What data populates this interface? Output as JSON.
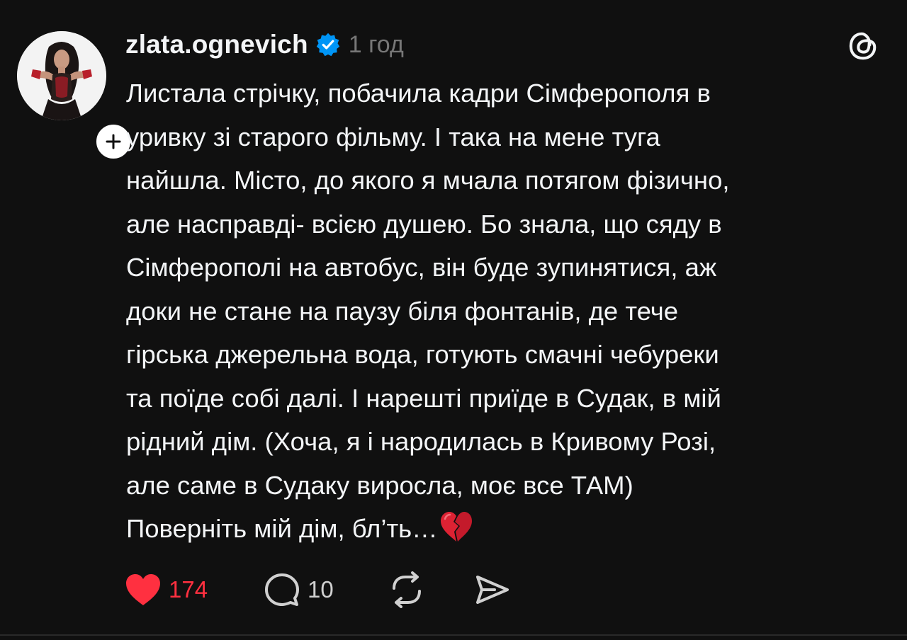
{
  "post": {
    "username": "zlata.ognevich",
    "verified": true,
    "timestamp": "1 год",
    "text_lines": [
      "Листала стрічку, побачила кадри Сімферополя в",
      "уривку зі старого фільму. І така на мене туга",
      "найшла. Місто, до якого я мчала потягом фізично,",
      "але насправді- всією душею. Бо знала, що сяду в",
      "Сімферополі на автобус, він буде зупинятися, аж",
      "доки не стане на паузу біля фонтанів, де тече",
      "гірська джерельна вода, готують смачні чебуреки",
      "та поїде собі далі. І нарешті приїде в Судак, в мій",
      "рідний дім. (Хоча, я і народилась в Кривому Розі,",
      "але саме в Судаку виросла, моє все ТАМ)",
      "Поверніть мій дім, бл’ть…"
    ],
    "emoji": "broken-heart-emoji"
  },
  "actions": {
    "likes": "174",
    "replies": "10",
    "liked": true
  },
  "colors": {
    "background": "#101010",
    "text": "#f3f5f7",
    "muted": "#777777",
    "like": "#ff3040",
    "verified": "#0095f6"
  },
  "icons": {
    "follow": "plus-icon",
    "verified": "verified-badge-icon",
    "logo": "threads-logo-icon",
    "like": "heart-icon",
    "reply": "comment-icon",
    "repost": "repost-icon",
    "share": "share-icon"
  }
}
